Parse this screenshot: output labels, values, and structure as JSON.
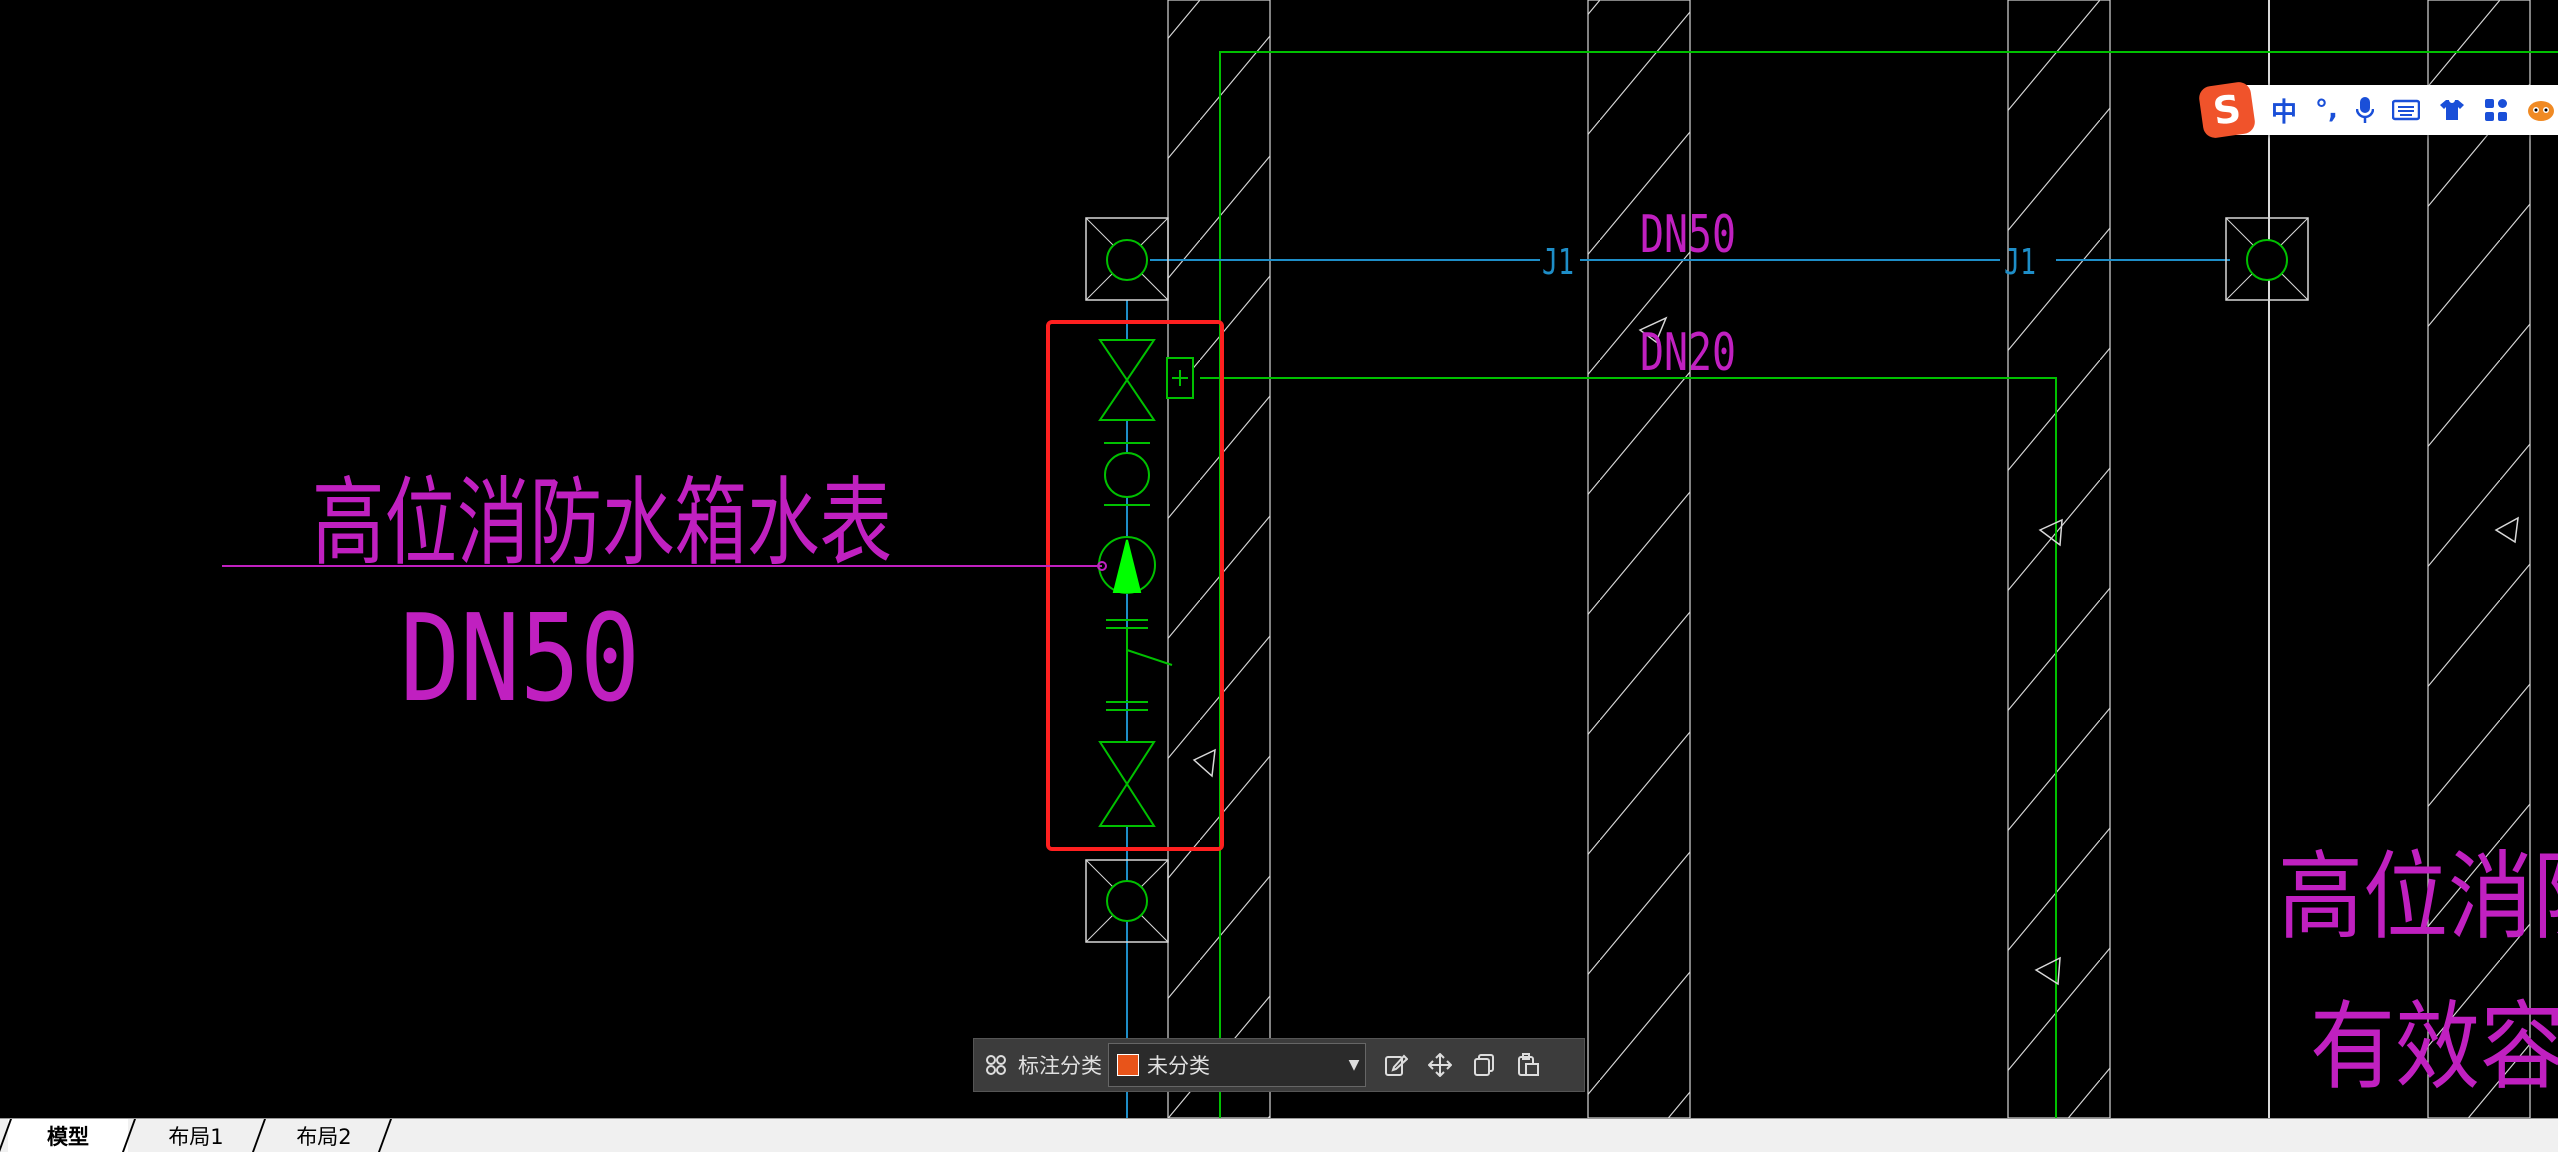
{
  "drawing": {
    "label_main": "高位消防水箱水表",
    "label_main_size": "DN50",
    "pipe_label_upper": "DN50",
    "pipe_label_lower": "DN20",
    "pipe_tag_1": "J1",
    "pipe_tag_2": "J1",
    "partial_label_line1": "高位消防",
    "partial_label_line2": "有效容积",
    "colors": {
      "magenta": "#c020c0",
      "green": "#00c000",
      "blue": "#1e8ec8",
      "white": "#d8d8d8",
      "highlight": "#ff2020"
    }
  },
  "ime_toolbar": {
    "logo": "S",
    "mode": "中",
    "punct": "°,",
    "icons": [
      "microphone-icon",
      "keyboard-icon",
      "skin-icon",
      "toolbox-icon",
      "mascot-icon"
    ]
  },
  "annotation_toolbar": {
    "label": "标注分类",
    "selected_category": "未分类",
    "category_color": "#e8541a",
    "icons": [
      "grid-icon",
      "edit-icon",
      "move-icon",
      "copy-icon",
      "paste-icon"
    ]
  },
  "tabs": [
    {
      "label": "模型",
      "active": true
    },
    {
      "label": "布局1",
      "active": false
    },
    {
      "label": "布局2",
      "active": false
    }
  ]
}
